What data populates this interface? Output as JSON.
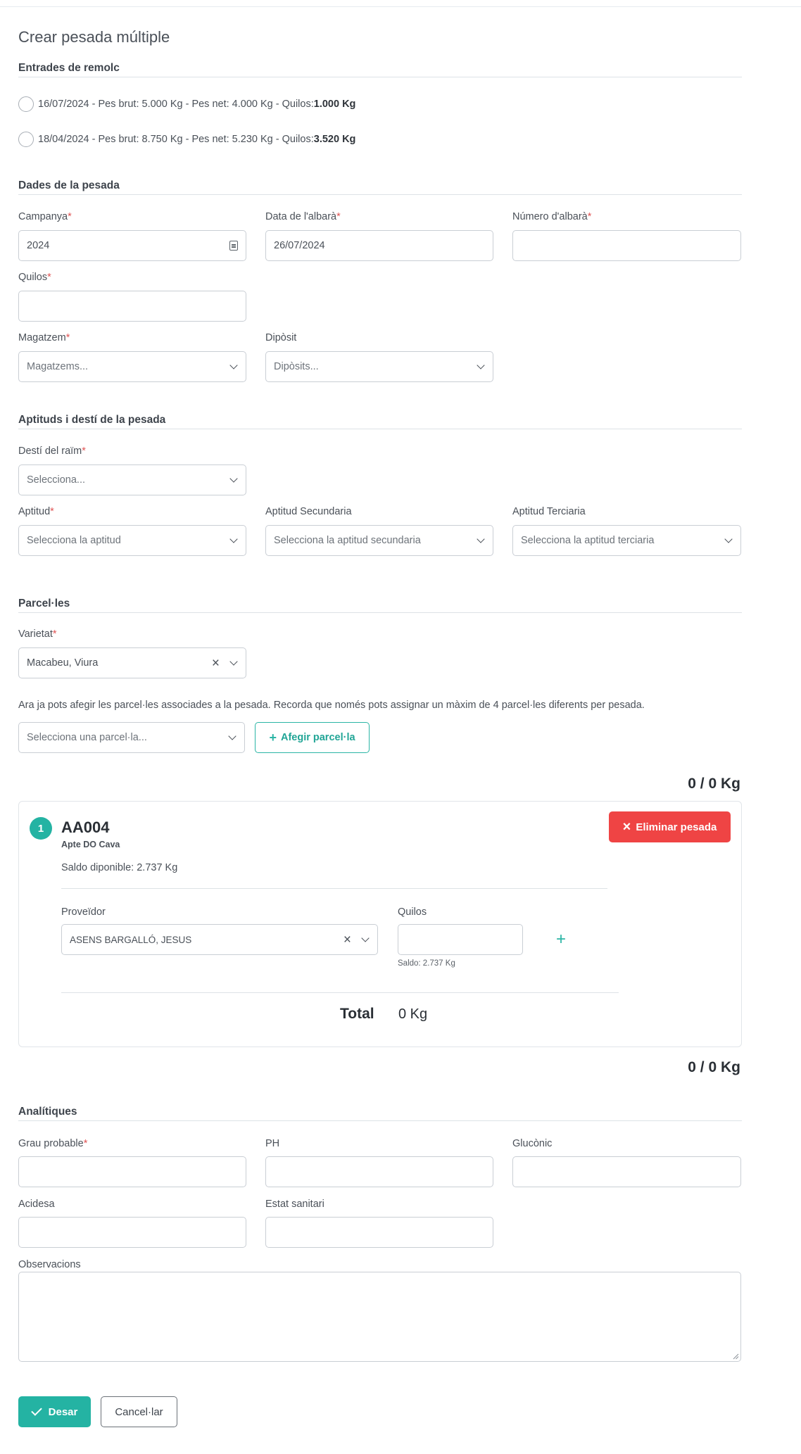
{
  "page": {
    "title": "Crear pesada múltiple"
  },
  "trailer": {
    "title": "Entrades de remolc",
    "entries": [
      {
        "text": "16/07/2024 - Pes brut: 5.000 Kg - Pes net: 4.000 Kg - Quilos: ",
        "bold": "1.000 Kg"
      },
      {
        "text": "18/04/2024 - Pes brut: 8.750 Kg - Pes net: 5.230 Kg - Quilos: ",
        "bold": "3.520 Kg"
      }
    ]
  },
  "weighing": {
    "title": "Dades de la pesada",
    "campaign_label": "Campanya",
    "campaign_value": "2024",
    "date_label": "Data de l'albarà",
    "date_value": "26/07/2024",
    "number_label": "Número d'albarà",
    "number_value": "",
    "kilos_label": "Quilos",
    "kilos_value": "",
    "warehouse_label": "Magatzem",
    "warehouse_placeholder": "Magatzems...",
    "deposit_label": "Dipòsit",
    "deposit_placeholder": "Dipòsits...",
    "required_mark": "*"
  },
  "aptitudes": {
    "title": "Aptituds i destí de la pesada",
    "destination_label": "Destí del raïm",
    "destination_placeholder": "Selecciona...",
    "aptitude_label": "Aptitud",
    "aptitude_placeholder": "Selecciona la aptitud",
    "secondary_label": "Aptitud Secundaria",
    "secondary_placeholder": "Selecciona la aptitud secundaria",
    "tertiary_label": "Aptitud Terciaria",
    "tertiary_placeholder": "Selecciona la aptitud terciaria"
  },
  "parcels": {
    "title": "Parcel·les",
    "variety_label": "Varietat",
    "variety_value": "Macabeu, Viura",
    "info": "Ara ja pots afegir les parcel·les associades a la pesada. Recorda que només pots assignar un màxim de 4 parcel·les diferents per pesada.",
    "select_placeholder": "Selecciona una parcel·la...",
    "add_button": "Afegir parcel·la",
    "total_top": "0 / 0 Kg",
    "total_bottom": "0 / 0 Kg",
    "card": {
      "index": "1",
      "code": "AA004",
      "subtitle": "Apte DO Cava",
      "balance": "Saldo diponible: 2.737 Kg",
      "delete_button": "Eliminar pesada",
      "provider_label": "Proveïdor",
      "provider_value": "ASENS BARGALLÓ, JESUS",
      "kilos_label": "Quilos",
      "kilos_value": "",
      "kilos_balance": "Saldo: 2.737 Kg",
      "total_label": "Total",
      "total_value": "0 Kg"
    }
  },
  "analytics": {
    "title": "Analítiques",
    "grade_label": "Grau probable",
    "ph_label": "PH",
    "gluconic_label": "Glucònic",
    "acidity_label": "Acidesa",
    "health_label": "Estat sanitari",
    "observations_label": "Observacions"
  },
  "actions": {
    "save": "Desar",
    "cancel": "Cancel·lar"
  }
}
